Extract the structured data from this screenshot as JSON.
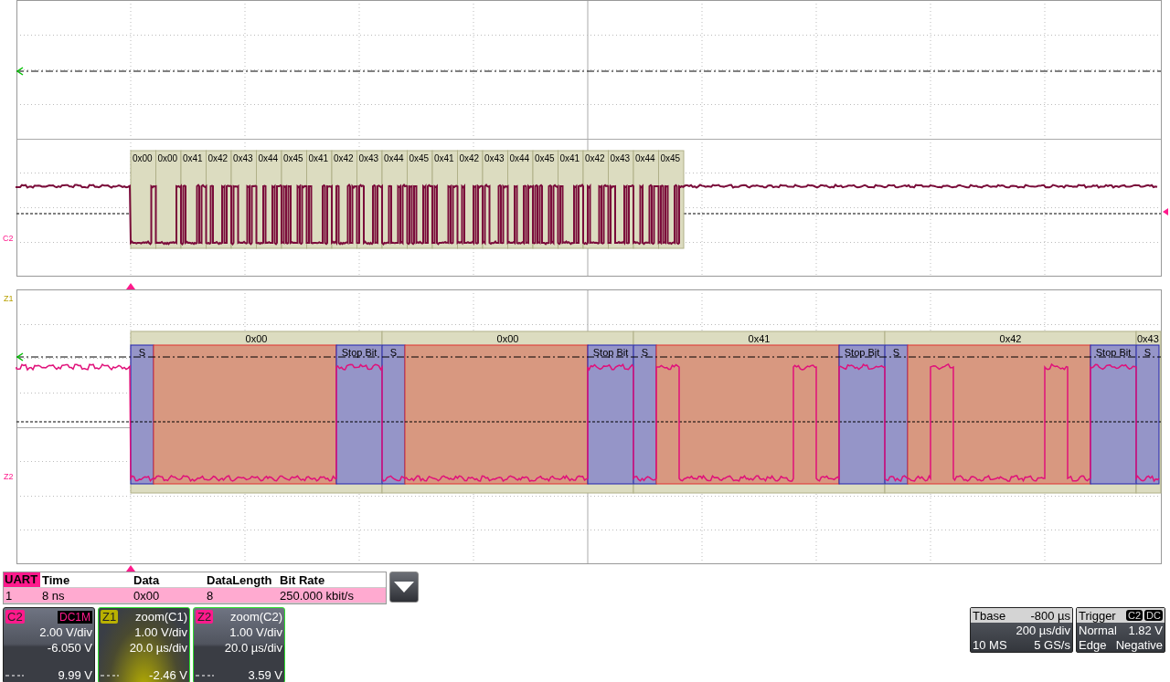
{
  "main_grid": {
    "channel_label": "C2",
    "frames": [
      "0x00",
      "0x00",
      "0x41",
      "0x42",
      "0x43",
      "0x44",
      "0x45",
      "0x41",
      "0x42",
      "0x43",
      "0x44",
      "0x45",
      "0x41",
      "0x42",
      "0x43",
      "0x44",
      "0x45",
      "0x41",
      "0x42",
      "0x43",
      "0x44",
      "0x45"
    ]
  },
  "zoom_grid": {
    "channel_labels": [
      "Z1",
      "Z2"
    ],
    "frames": [
      {
        "byte": "0x00",
        "segments": [
          {
            "kind": "start",
            "label": "S"
          },
          {
            "kind": "data"
          },
          {
            "kind": "stop",
            "label": "Stop Bit"
          }
        ]
      },
      {
        "byte": "0x00",
        "segments": [
          {
            "kind": "start",
            "label": "S"
          },
          {
            "kind": "data"
          },
          {
            "kind": "stop",
            "label": "Stop Bit"
          }
        ]
      },
      {
        "byte": "0x41",
        "segments": [
          {
            "kind": "start",
            "label": "S"
          },
          {
            "kind": "data"
          },
          {
            "kind": "stop",
            "label": "Stop Bit"
          }
        ]
      },
      {
        "byte": "0x42",
        "segments": [
          {
            "kind": "start",
            "label": "S"
          },
          {
            "kind": "data"
          },
          {
            "kind": "stop",
            "label": "Stop Bit"
          }
        ]
      },
      {
        "byte": "0x43",
        "segments": [
          {
            "kind": "start",
            "label": "S"
          }
        ]
      }
    ]
  },
  "decode_table": {
    "columns": [
      "UART",
      "Time",
      "Data",
      "DataLength",
      "Bit Rate"
    ],
    "rows": [
      [
        "1",
        "8 ns",
        "0x00",
        "8",
        "250.000 kbit/s"
      ]
    ]
  },
  "channel_boxes": [
    {
      "kind": "channel",
      "badge": "C2",
      "color": "#ff1a8c",
      "coupling": "DC1M",
      "lines": [
        "2.00 V/div",
        "-6.050 V"
      ],
      "offset": "9.99 V"
    },
    {
      "kind": "zoom",
      "badge": "Z1",
      "color": "#b8b000",
      "source": "zoom(C1)",
      "lines": [
        "1.00 V/div",
        "20.0 µs/div"
      ],
      "offset": "-2.46 V"
    },
    {
      "kind": "zoom",
      "badge": "Z2",
      "color": "#ff1a8c",
      "source": "zoom(C2)",
      "lines": [
        "1.00 V/div",
        "20.0 µs/div"
      ],
      "offset": "3.59 V"
    }
  ],
  "timebase": {
    "title": "Tbase",
    "delay": "-800 µs",
    "scale": "200 µs/div",
    "memory": "10 MS",
    "sample_rate": "5 GS/s"
  },
  "trigger": {
    "title": "Trigger",
    "source": "C2",
    "coupling": "DC",
    "mode": "Normal",
    "threshold": "1.82 V",
    "type": "Edge",
    "slope": "Negative"
  }
}
